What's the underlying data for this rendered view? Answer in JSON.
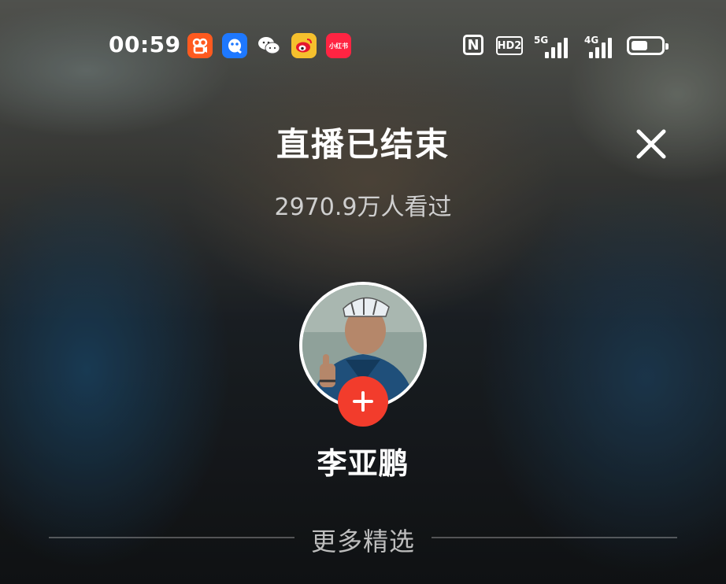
{
  "status_bar": {
    "time": "00:59",
    "apps": [
      {
        "name": "kuaishou-app-icon",
        "color": "#ff5a1f"
      },
      {
        "name": "qq-app-icon",
        "color": "#1e78ff"
      },
      {
        "name": "wechat-app-icon",
        "color": "transparent"
      },
      {
        "name": "weibo-app-icon",
        "color": "#f5c02d"
      },
      {
        "name": "xiaohongshu-app-icon",
        "color": "#ff2442",
        "label": "小红书"
      }
    ],
    "nfc_label": "N",
    "hd_label": "HD2",
    "signal1_label": "5G",
    "signal2_label": "4G",
    "battery_level": 0.55
  },
  "header": {
    "title": "直播已结束",
    "views": "2970.9万人看过"
  },
  "profile": {
    "name": "李亚鹏",
    "accent_color": "#f23c2c"
  },
  "more_section": {
    "label": "更多精选"
  }
}
